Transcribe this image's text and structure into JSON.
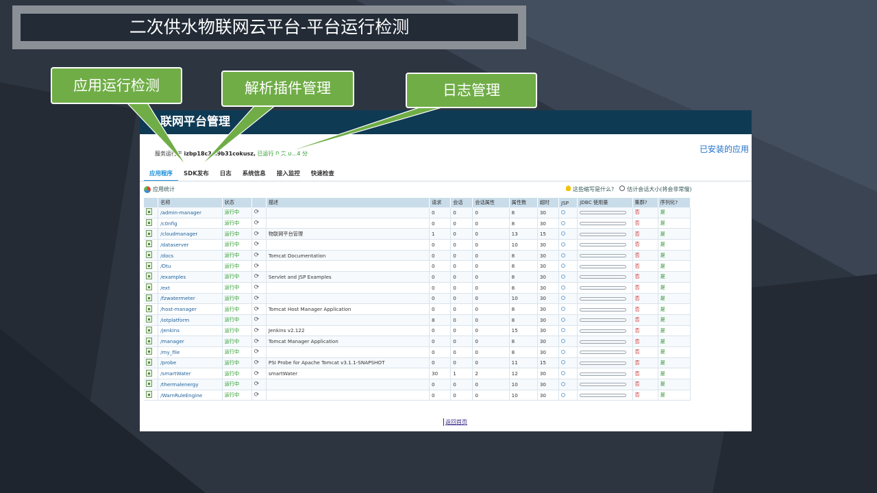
{
  "slide_title": "二次供水物联网云平台-平台运行检测",
  "panel": {
    "header_title": "联网平台管理",
    "server_prefix": "服务运行于",
    "server_host": "izbp18c3…9b31cokusz,",
    "uptime_text": "已运行 0 天 0…4 分",
    "installed_apps_link": "已安装的应用"
  },
  "tabs": [
    {
      "label": "应用程序",
      "active": true
    },
    {
      "label": "SDK发布",
      "active": false
    },
    {
      "label": "日志",
      "active": false
    },
    {
      "label": "系统信息",
      "active": false
    },
    {
      "label": "接入监控",
      "active": false
    },
    {
      "label": "快速检查",
      "active": false
    }
  ],
  "app_stats_label": "应用统计",
  "help": {
    "abbrev_label": "这些缩写是什么?",
    "session_size_label": "估计会话大小(将会非常慢)"
  },
  "table": {
    "headers": [
      "",
      "名称",
      "状态",
      "",
      "描述",
      "请求",
      "会话",
      "会话属性",
      "属性数",
      "超时",
      "JSP",
      "JDBC 使用量",
      "集群?",
      "序列化?"
    ],
    "rows": [
      {
        "name": "/admin-manager",
        "status": "运行中",
        "desc": "",
        "req": "0",
        "sess": "0",
        "attr": "0",
        "props": "8",
        "timeout": "30",
        "cluster": "否",
        "serial": "是"
      },
      {
        "name": "/c0nfig",
        "status": "运行中",
        "desc": "",
        "req": "0",
        "sess": "0",
        "attr": "0",
        "props": "8",
        "timeout": "30",
        "cluster": "否",
        "serial": "是"
      },
      {
        "name": "/cloudmanager",
        "status": "运行中",
        "desc": "物联网平台管理",
        "req": "1",
        "sess": "0",
        "attr": "0",
        "props": "13",
        "timeout": "15",
        "cluster": "否",
        "serial": "是"
      },
      {
        "name": "/dataserver",
        "status": "运行中",
        "desc": "",
        "req": "0",
        "sess": "0",
        "attr": "0",
        "props": "10",
        "timeout": "30",
        "cluster": "否",
        "serial": "是"
      },
      {
        "name": "/docs",
        "status": "运行中",
        "desc": "Tomcat Documentation",
        "req": "0",
        "sess": "0",
        "attr": "0",
        "props": "8",
        "timeout": "30",
        "cluster": "否",
        "serial": "是"
      },
      {
        "name": "/Dtu",
        "status": "运行中",
        "desc": "",
        "req": "0",
        "sess": "0",
        "attr": "0",
        "props": "8",
        "timeout": "30",
        "cluster": "否",
        "serial": "是"
      },
      {
        "name": "/examples",
        "status": "运行中",
        "desc": "Servlet and JSP Examples",
        "req": "0",
        "sess": "0",
        "attr": "0",
        "props": "8",
        "timeout": "30",
        "cluster": "否",
        "serial": "是"
      },
      {
        "name": "/ext",
        "status": "运行中",
        "desc": "",
        "req": "0",
        "sess": "0",
        "attr": "0",
        "props": "8",
        "timeout": "30",
        "cluster": "否",
        "serial": "是"
      },
      {
        "name": "/fzwatermeter",
        "status": "运行中",
        "desc": "",
        "req": "0",
        "sess": "0",
        "attr": "0",
        "props": "10",
        "timeout": "30",
        "cluster": "否",
        "serial": "是"
      },
      {
        "name": "/host-manager",
        "status": "运行中",
        "desc": "Tomcat Host Manager Application",
        "req": "0",
        "sess": "0",
        "attr": "0",
        "props": "8",
        "timeout": "30",
        "cluster": "否",
        "serial": "是"
      },
      {
        "name": "/iotplatform",
        "status": "运行中",
        "desc": "",
        "req": "8",
        "sess": "0",
        "attr": "0",
        "props": "8",
        "timeout": "30",
        "cluster": "否",
        "serial": "是"
      },
      {
        "name": "/jenkins",
        "status": "运行中",
        "desc": "Jenkins v2.122",
        "req": "0",
        "sess": "0",
        "attr": "0",
        "props": "15",
        "timeout": "30",
        "cluster": "否",
        "serial": "是"
      },
      {
        "name": "/manager",
        "status": "运行中",
        "desc": "Tomcat Manager Application",
        "req": "0",
        "sess": "0",
        "attr": "0",
        "props": "8",
        "timeout": "30",
        "cluster": "否",
        "serial": "是"
      },
      {
        "name": "/my_file",
        "status": "运行中",
        "desc": "",
        "req": "0",
        "sess": "0",
        "attr": "0",
        "props": "8",
        "timeout": "30",
        "cluster": "否",
        "serial": "是"
      },
      {
        "name": "/probe",
        "status": "运行中",
        "desc": "PSI Probe for Apache Tomcat v3.1.1-SNAPSHOT",
        "req": "0",
        "sess": "0",
        "attr": "0",
        "props": "11",
        "timeout": "15",
        "cluster": "否",
        "serial": "是"
      },
      {
        "name": "/smartWater",
        "status": "运行中",
        "desc": "smartWater",
        "req": "30",
        "sess": "1",
        "attr": "2",
        "props": "12",
        "timeout": "30",
        "cluster": "否",
        "serial": "是"
      },
      {
        "name": "/thermalenergy",
        "status": "运行中",
        "desc": "",
        "req": "0",
        "sess": "0",
        "attr": "0",
        "props": "10",
        "timeout": "30",
        "cluster": "否",
        "serial": "是"
      },
      {
        "name": "/WarnRuleEngine",
        "status": "运行中",
        "desc": "",
        "req": "0",
        "sess": "0",
        "attr": "0",
        "props": "10",
        "timeout": "30",
        "cluster": "否",
        "serial": "是"
      }
    ]
  },
  "back_home_link": "返回首页",
  "callouts": {
    "app_monitor": "应用运行检测",
    "plugin_mgmt": "解析插件管理",
    "log_mgmt": "日志管理"
  },
  "colors": {
    "slide_bg": "#2c3440",
    "callout_green": "#70ad47",
    "panel_header": "#0f3a54",
    "running_green": "#2a9a2a",
    "no_red": "#d03030"
  }
}
